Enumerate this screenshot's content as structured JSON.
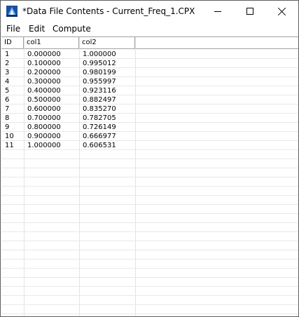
{
  "window": {
    "title": "*Data File Contents - Current_Freq_1.CPX"
  },
  "menu": {
    "items": [
      "File",
      "Edit",
      "Compute"
    ]
  },
  "table": {
    "columns": [
      "ID",
      "col1",
      "col2"
    ],
    "rows": [
      [
        "1",
        "0.000000",
        "1.000000"
      ],
      [
        "2",
        "0.100000",
        "0.995012"
      ],
      [
        "3",
        "0.200000",
        "0.980199"
      ],
      [
        "4",
        "0.300000",
        "0.955997"
      ],
      [
        "5",
        "0.400000",
        "0.923116"
      ],
      [
        "6",
        "0.500000",
        "0.882497"
      ],
      [
        "7",
        "0.600000",
        "0.835270"
      ],
      [
        "8",
        "0.700000",
        "0.782705"
      ],
      [
        "9",
        "0.800000",
        "0.726149"
      ],
      [
        "10",
        "0.900000",
        "0.666977"
      ],
      [
        "11",
        "1.000000",
        "0.606531"
      ]
    ]
  }
}
